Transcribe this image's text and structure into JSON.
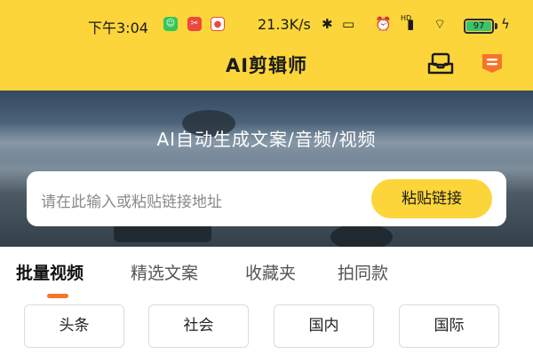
{
  "status_bar": {
    "time": "下午3:04",
    "net_speed": "21.3K/s",
    "network_label": "HD",
    "battery": "97"
  },
  "header": {
    "title": "AI剪辑师",
    "accent_color": "#fcd53a"
  },
  "hero": {
    "tagline": "AI自动生成文案/音频/视频"
  },
  "search": {
    "placeholder": "请在此输入或粘贴链接地址",
    "paste_label": "粘贴链接"
  },
  "tabs": [
    {
      "label": "批量视频",
      "active": true
    },
    {
      "label": "精选文案",
      "active": false
    },
    {
      "label": "收藏夹",
      "active": false
    },
    {
      "label": "拍同款",
      "active": false
    }
  ],
  "categories": [
    "头条",
    "社会",
    "国内",
    "国际"
  ],
  "icons": {
    "inbox": "inbox-icon",
    "menu": "menu-icon"
  },
  "colors": {
    "tab_indicator": "#f6742a",
    "battery_fill": "#39c36b"
  }
}
